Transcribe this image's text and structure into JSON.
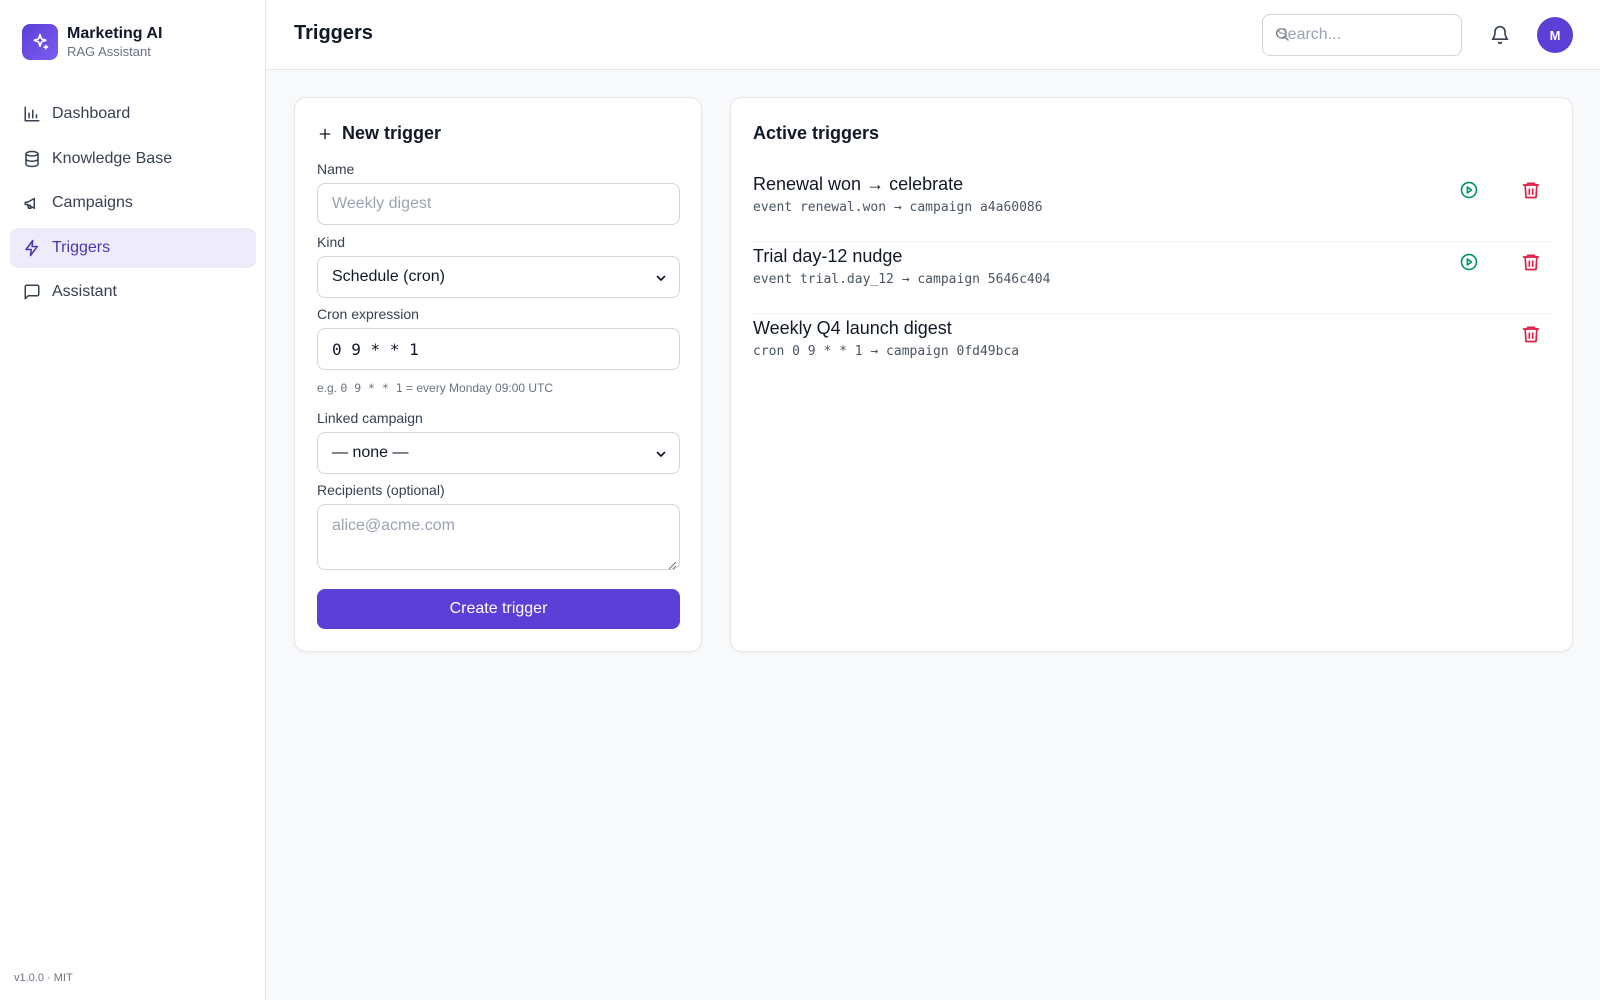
{
  "brand": {
    "name": "Marketing AI",
    "subtitle": "RAG Assistant"
  },
  "nav": [
    {
      "label": "Dashboard",
      "icon": "bar-chart-icon",
      "active": false
    },
    {
      "label": "Knowledge Base",
      "icon": "database-icon",
      "active": false
    },
    {
      "label": "Campaigns",
      "icon": "megaphone-icon",
      "active": false
    },
    {
      "label": "Triggers",
      "icon": "zap-icon",
      "active": true
    },
    {
      "label": "Assistant",
      "icon": "message-square-icon",
      "active": false
    }
  ],
  "footer": {
    "version": "v1.0.0 · MIT"
  },
  "header": {
    "title": "Triggers",
    "search_placeholder": "Search...",
    "avatar_initial": "M"
  },
  "new_trigger": {
    "title": "New trigger",
    "name_label": "Name",
    "name_placeholder": "Weekly digest",
    "kind_label": "Kind",
    "kind_value": "Schedule (cron)",
    "cron_label": "Cron expression",
    "cron_value": "0 9 * * 1",
    "hint_prefix": "e.g.",
    "hint_code": "0 9 * * 1",
    "hint_suffix": "= every Monday 09:00 UTC",
    "campaign_label": "Linked campaign",
    "campaign_value": "— none —",
    "recipients_label": "Recipients (optional)",
    "recipients_placeholder": "alice@acme.com",
    "create_label": "Create trigger"
  },
  "active_triggers": {
    "title": "Active triggers",
    "items": [
      {
        "name": "Renewal won → celebrate",
        "meta": "event renewal.won → campaign a4a60086",
        "has_run": true
      },
      {
        "name": "Trial day-12 nudge",
        "meta": "event trial.day_12 → campaign 5646c404",
        "has_run": true
      },
      {
        "name": "Weekly Q4 launch digest",
        "meta": "cron 0 9 * * 1 → campaign 0fd49bca",
        "has_run": false
      }
    ]
  },
  "colors": {
    "accent": "#5b3fd6",
    "active_nav_bg": "#eeebfb",
    "run_green": "#059669",
    "delete_red": "#e11d48"
  }
}
